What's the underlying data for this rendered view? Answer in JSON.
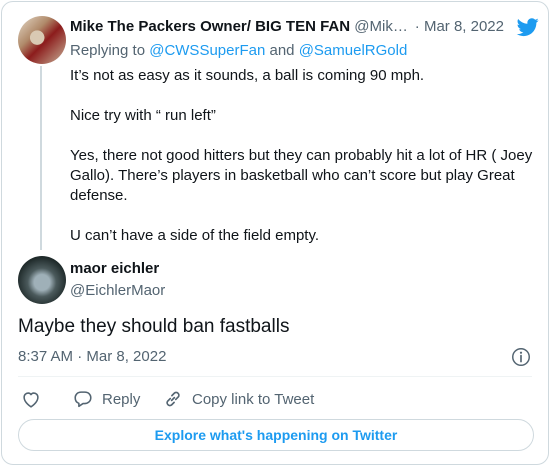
{
  "parent_tweet": {
    "author_name": "Mike The Packers Owner/ BIG TEN FAN",
    "author_handle": "@Mik…",
    "date": "· Mar 8, 2022",
    "replying_prefix": "Replying to",
    "replying_to_1": "@CWSSuperFan",
    "replying_and": "and",
    "replying_to_2": "@SamuelRGold",
    "paragraphs": [
      "It’s not as easy as it sounds, a ball is coming 90 mph.",
      "Nice try with “ run left”",
      "Yes, there not good hitters but they can probably hit a lot of HR ( Joey Gallo). There’s players in basketball who can’t score but play Great defense.",
      "U can’t have a side of the field empty."
    ]
  },
  "main_tweet": {
    "author_name": "maor eichler",
    "author_handle": "@EichlerMaor",
    "text": "Maybe they should ban fastballs",
    "timestamp": "8:37 AM · Mar 8, 2022"
  },
  "actions": {
    "reply_label": "Reply",
    "copy_link_label": "Copy link to Tweet"
  },
  "explore_button": "Explore what's happening on Twitter",
  "colors": {
    "brand_blue": "#1d9bf0",
    "text_primary": "#0f1419",
    "text_secondary": "#536471",
    "border": "#cfd9de"
  },
  "icons": {
    "logo": "twitter-bird-icon",
    "info": "info-icon",
    "like": "heart-icon",
    "reply": "speech-bubble-icon",
    "copy_link": "link-icon"
  }
}
